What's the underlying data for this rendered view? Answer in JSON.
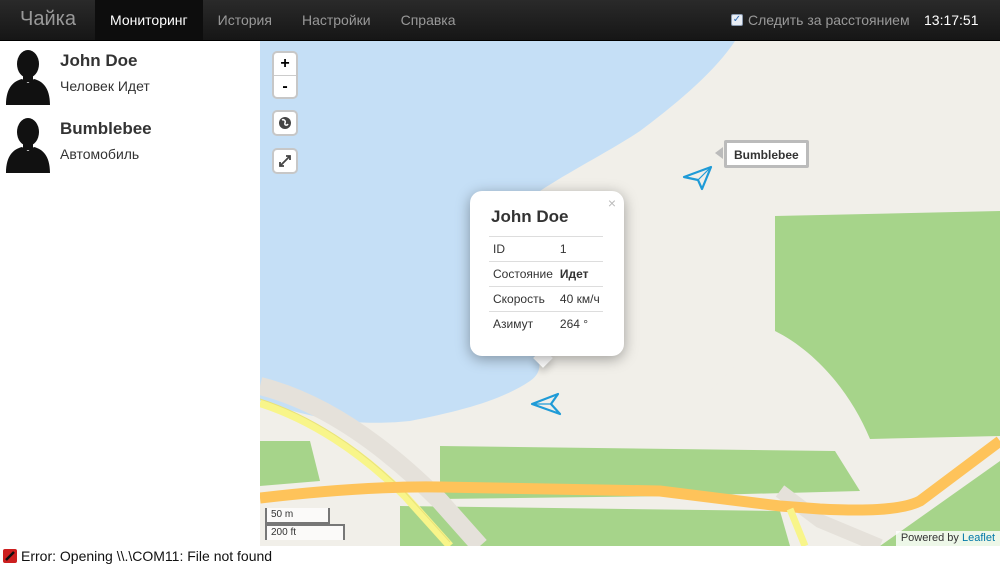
{
  "navbar": {
    "brand": "Чайка",
    "items": [
      {
        "label": "Мониторинг",
        "active": true
      },
      {
        "label": "История",
        "active": false
      },
      {
        "label": "Настройки",
        "active": false
      },
      {
        "label": "Справка",
        "active": false
      }
    ],
    "track_distance_label": "Следить за расстоянием",
    "track_distance_checked": true,
    "clock": "13:17:51"
  },
  "devices": [
    {
      "name": "John Doe",
      "status": "Человек Идет"
    },
    {
      "name": "Bumblebee",
      "status": "Автомобиль"
    }
  ],
  "map": {
    "zoom_in": "+",
    "zoom_out": "-",
    "popup": {
      "title": "John Doe",
      "close": "×",
      "rows": [
        {
          "key": "ID",
          "value": "1",
          "bold": false
        },
        {
          "key": "Состояние",
          "value": "Идет",
          "bold": true
        },
        {
          "key": "Скорость",
          "value": "40 км/ч",
          "bold": false
        },
        {
          "key": "Азимут",
          "value": "264 °",
          "bold": false
        }
      ]
    },
    "marker_label": "Bumblebee",
    "scale_metric": "50 m",
    "scale_imperial": "200 ft",
    "attribution_prefix": "Powered by",
    "attribution_link": "Leaflet"
  },
  "statusbar": {
    "message": "Error: Opening \\\\.\\COM11: File not found"
  },
  "colors": {
    "water": "#c5dff6",
    "land": "#f1efe9",
    "park": "#a6d48a",
    "road_major": "#fec35a",
    "road_minor": "#f8f58a",
    "marker": "#1f9bd7"
  }
}
